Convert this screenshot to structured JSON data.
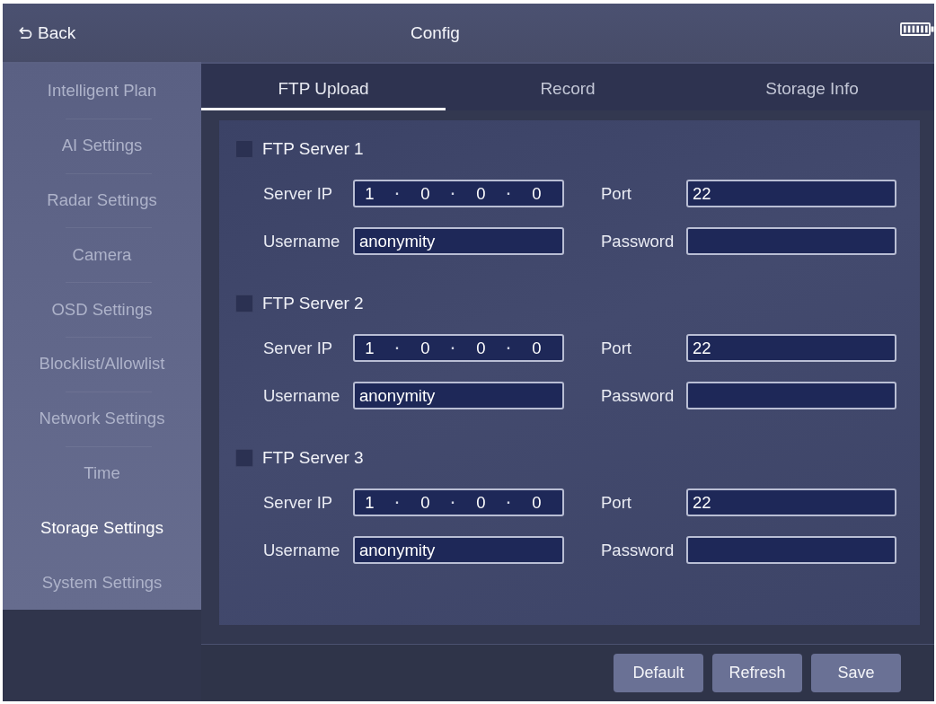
{
  "header": {
    "back": "Back",
    "title": "Config"
  },
  "sidebar": {
    "items": [
      {
        "label": "Intelligent Plan",
        "selected": false
      },
      {
        "label": "AI Settings",
        "selected": false
      },
      {
        "label": "Radar Settings",
        "selected": false
      },
      {
        "label": "Camera",
        "selected": false
      },
      {
        "label": "OSD Settings",
        "selected": false
      },
      {
        "label": "Blocklist/Allowlist",
        "selected": false
      },
      {
        "label": "Network Settings",
        "selected": false
      },
      {
        "label": "Time",
        "selected": false
      },
      {
        "label": "Storage Settings",
        "selected": true
      },
      {
        "label": "System Settings",
        "selected": false
      }
    ]
  },
  "tabs": [
    {
      "label": "FTP Upload",
      "selected": true
    },
    {
      "label": "Record",
      "selected": false
    },
    {
      "label": "Storage Info",
      "selected": false
    }
  ],
  "ftp_servers": [
    {
      "title": "FTP Server 1",
      "checked": false,
      "server_ip": {
        "label": "Server IP",
        "segments": [
          "1",
          "·",
          "0",
          "·",
          "0",
          "·",
          "0"
        ]
      },
      "port": {
        "label": "Port",
        "value": "22"
      },
      "username": {
        "label": "Username",
        "value": "anonymity"
      },
      "password": {
        "label": "Password"
      }
    },
    {
      "title": "FTP Server 2",
      "checked": false,
      "server_ip": {
        "label": "Server IP",
        "segments": [
          "1",
          "·",
          "0",
          "·",
          "0",
          "·",
          "0"
        ]
      },
      "port": {
        "label": "Port",
        "value": "22"
      },
      "username": {
        "label": "Username",
        "value": "anonymity"
      },
      "password": {
        "label": "Password"
      }
    },
    {
      "title": "FTP Server 3",
      "checked": false,
      "server_ip": {
        "label": "Server IP",
        "segments": [
          "1",
          "·",
          "0",
          "·",
          "0",
          "·",
          "0"
        ]
      },
      "port": {
        "label": "Port",
        "value": "22"
      },
      "username": {
        "label": "Username",
        "value": "anonymity"
      },
      "password": {
        "label": "Password"
      }
    }
  ],
  "buttons": [
    "Default",
    "Refresh",
    "Save"
  ]
}
